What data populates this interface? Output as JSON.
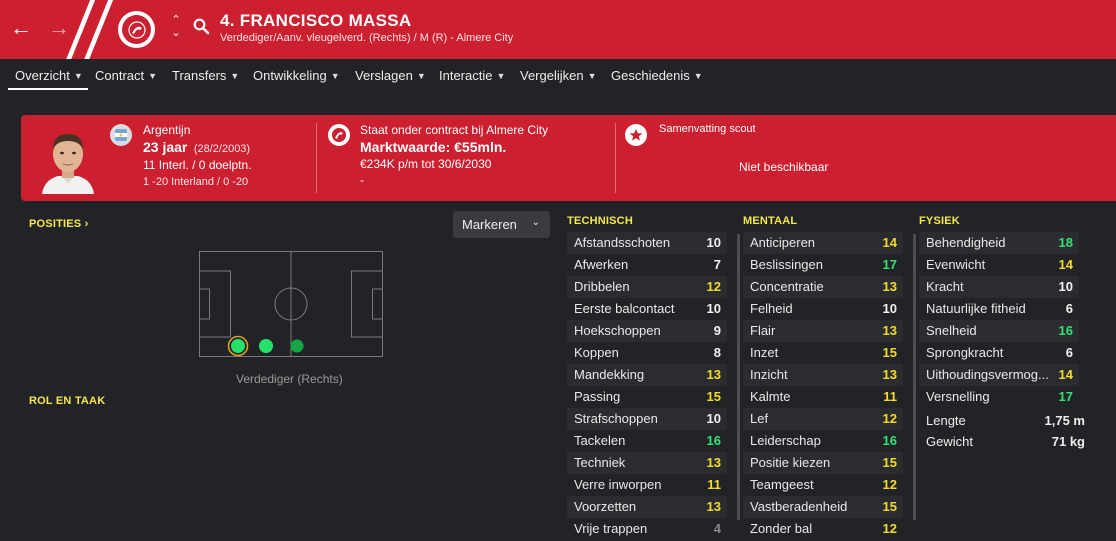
{
  "header": {
    "player_name": "4. FRANCISCO MASSA",
    "player_subtitle": "Verdediger/Aanv. vleugelverd. (Rechts) / M (R) - Almere City"
  },
  "tabs": [
    {
      "label": "Overzicht"
    },
    {
      "label": "Contract"
    },
    {
      "label": "Transfers"
    },
    {
      "label": "Ontwikkeling"
    },
    {
      "label": "Verslagen"
    },
    {
      "label": "Interactie"
    },
    {
      "label": "Vergelijken"
    },
    {
      "label": "Geschiedenis"
    }
  ],
  "banner": {
    "nationality": "Argentijn",
    "age": "23 jaar",
    "birthdate": "(28/2/2003)",
    "caps": "11 Interl. / 0 doelptn.",
    "u20": "1 -20 Interland / 0 -20",
    "contract_status": "Staat onder contract bij Almere City",
    "market_value": "Marktwaarde: €55mln.",
    "wage": "€234K p/m tot 30/6/2030",
    "dash": "-",
    "scout_title": "Samenvatting scout",
    "scout_value": "Niet beschikbaar"
  },
  "left": {
    "positions_title": "POSITIES",
    "highlight_button": "Markeren",
    "position_label": "Verdediger (Rechts)",
    "role_title": "ROL EN TAAK"
  },
  "technical": {
    "title": "TECHNISCH",
    "rows": [
      {
        "name": "Afstandsschoten",
        "value": "10"
      },
      {
        "name": "Afwerken",
        "value": "7"
      },
      {
        "name": "Dribbelen",
        "value": "12"
      },
      {
        "name": "Eerste balcontact",
        "value": "10"
      },
      {
        "name": "Hoekschoppen",
        "value": "9"
      },
      {
        "name": "Koppen",
        "value": "8"
      },
      {
        "name": "Mandekking",
        "value": "13"
      },
      {
        "name": "Passing",
        "value": "15"
      },
      {
        "name": "Strafschoppen",
        "value": "10"
      },
      {
        "name": "Tackelen",
        "value": "16"
      },
      {
        "name": "Techniek",
        "value": "13"
      },
      {
        "name": "Verre inworpen",
        "value": "11"
      },
      {
        "name": "Voorzetten",
        "value": "13"
      },
      {
        "name": "Vrije trappen",
        "value": "4"
      }
    ]
  },
  "mental": {
    "title": "MENTAAL",
    "rows": [
      {
        "name": "Anticiperen",
        "value": "14"
      },
      {
        "name": "Beslissingen",
        "value": "17"
      },
      {
        "name": "Concentratie",
        "value": "13"
      },
      {
        "name": "Felheid",
        "value": "10"
      },
      {
        "name": "Flair",
        "value": "13"
      },
      {
        "name": "Inzet",
        "value": "15"
      },
      {
        "name": "Inzicht",
        "value": "13"
      },
      {
        "name": "Kalmte",
        "value": "11"
      },
      {
        "name": "Lef",
        "value": "12"
      },
      {
        "name": "Leiderschap",
        "value": "16"
      },
      {
        "name": "Positie kiezen",
        "value": "15"
      },
      {
        "name": "Teamgeest",
        "value": "12"
      },
      {
        "name": "Vastberadenheid",
        "value": "15"
      },
      {
        "name": "Zonder bal",
        "value": "12"
      }
    ]
  },
  "physical": {
    "title": "FYSIEK",
    "rows": [
      {
        "name": "Behendigheid",
        "value": "18"
      },
      {
        "name": "Evenwicht",
        "value": "14"
      },
      {
        "name": "Kracht",
        "value": "10"
      },
      {
        "name": "Natuurlijke fitheid",
        "value": "6"
      },
      {
        "name": "Snelheid",
        "value": "16"
      },
      {
        "name": "Sprongkracht",
        "value": "6"
      },
      {
        "name": "Uithoudingsvermog...",
        "value": "14"
      },
      {
        "name": "Versnelling",
        "value": "17"
      }
    ],
    "height_label": "Lengte",
    "height_value": "1,75 m",
    "weight_label": "Gewicht",
    "weight_value": "71 kg"
  },
  "colors": {
    "brand_red": "#cc1f30",
    "attr_yellow": "#f2dd2c",
    "attr_green": "#35e074",
    "section_yellow": "#f4e84d"
  }
}
